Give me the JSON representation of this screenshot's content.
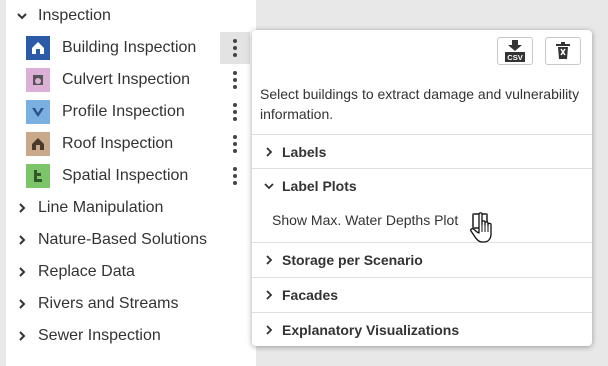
{
  "sidebar": {
    "header": {
      "label": "Inspection"
    },
    "tools": [
      {
        "label": "Building Inspection",
        "icon": "building-icon",
        "color": "#2a5aa8"
      },
      {
        "label": "Culvert Inspection",
        "icon": "culvert-icon",
        "color": "#d9a9d4"
      },
      {
        "label": "Profile Inspection",
        "icon": "profile-icon",
        "color": "#7ab0df"
      },
      {
        "label": "Roof Inspection",
        "icon": "roof-icon",
        "color": "#c9a98a"
      },
      {
        "label": "Spatial Inspection",
        "icon": "spatial-icon",
        "color": "#7cc46a"
      }
    ],
    "categories": [
      {
        "label": "Line Manipulation"
      },
      {
        "label": "Nature-Based Solutions"
      },
      {
        "label": "Replace Data"
      },
      {
        "label": "Rivers and Streams"
      },
      {
        "label": "Sewer Inspection"
      }
    ]
  },
  "panel": {
    "csv_label": "CSV",
    "description": "Select buildings to extract damage and vulnerability information.",
    "sections": [
      {
        "label": "Labels",
        "expanded": false
      },
      {
        "label": "Label Plots",
        "expanded": true
      },
      {
        "label": "Storage per Scenario",
        "expanded": false
      },
      {
        "label": "Facades",
        "expanded": false
      },
      {
        "label": "Explanatory Visualizations",
        "expanded": false
      }
    ],
    "option": {
      "label": "Show Max. Water Depths Plot",
      "checked": false
    }
  }
}
